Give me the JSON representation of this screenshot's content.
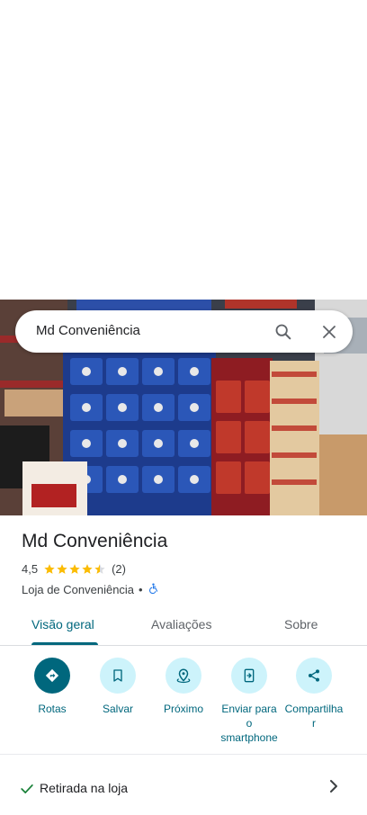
{
  "search": {
    "query": "Md Conveniência"
  },
  "place": {
    "name": "Md Conveniência",
    "rating": "4,5",
    "rating_stars": 4.5,
    "review_count": "(2)",
    "category": "Loja de Conveniência",
    "separator": "•",
    "accessible_icon": "wheelchair-icon"
  },
  "tabs": [
    {
      "label": "Visão geral",
      "active": true
    },
    {
      "label": "Avaliações",
      "active": false
    },
    {
      "label": "Sobre",
      "active": false
    }
  ],
  "actions": [
    {
      "label": "Rotas",
      "icon": "directions-icon"
    },
    {
      "label": "Salvar",
      "icon": "bookmark-icon"
    },
    {
      "label": "Próximo",
      "icon": "nearby-icon"
    },
    {
      "label_line1": "Enviar para",
      "label_line2": "o",
      "label_line3": "smartphone",
      "icon": "send-to-phone-icon"
    },
    {
      "label_line1": "Compartilha",
      "label_line2": "r",
      "icon": "share-icon"
    }
  ],
  "features": [
    {
      "label": "Retirada na loja",
      "icon": "check-icon"
    }
  ],
  "colors": {
    "accent": "#00677d",
    "accent_light": "#cdf3fb",
    "star": "#fbbc04",
    "accessible": "#1a73e8"
  }
}
